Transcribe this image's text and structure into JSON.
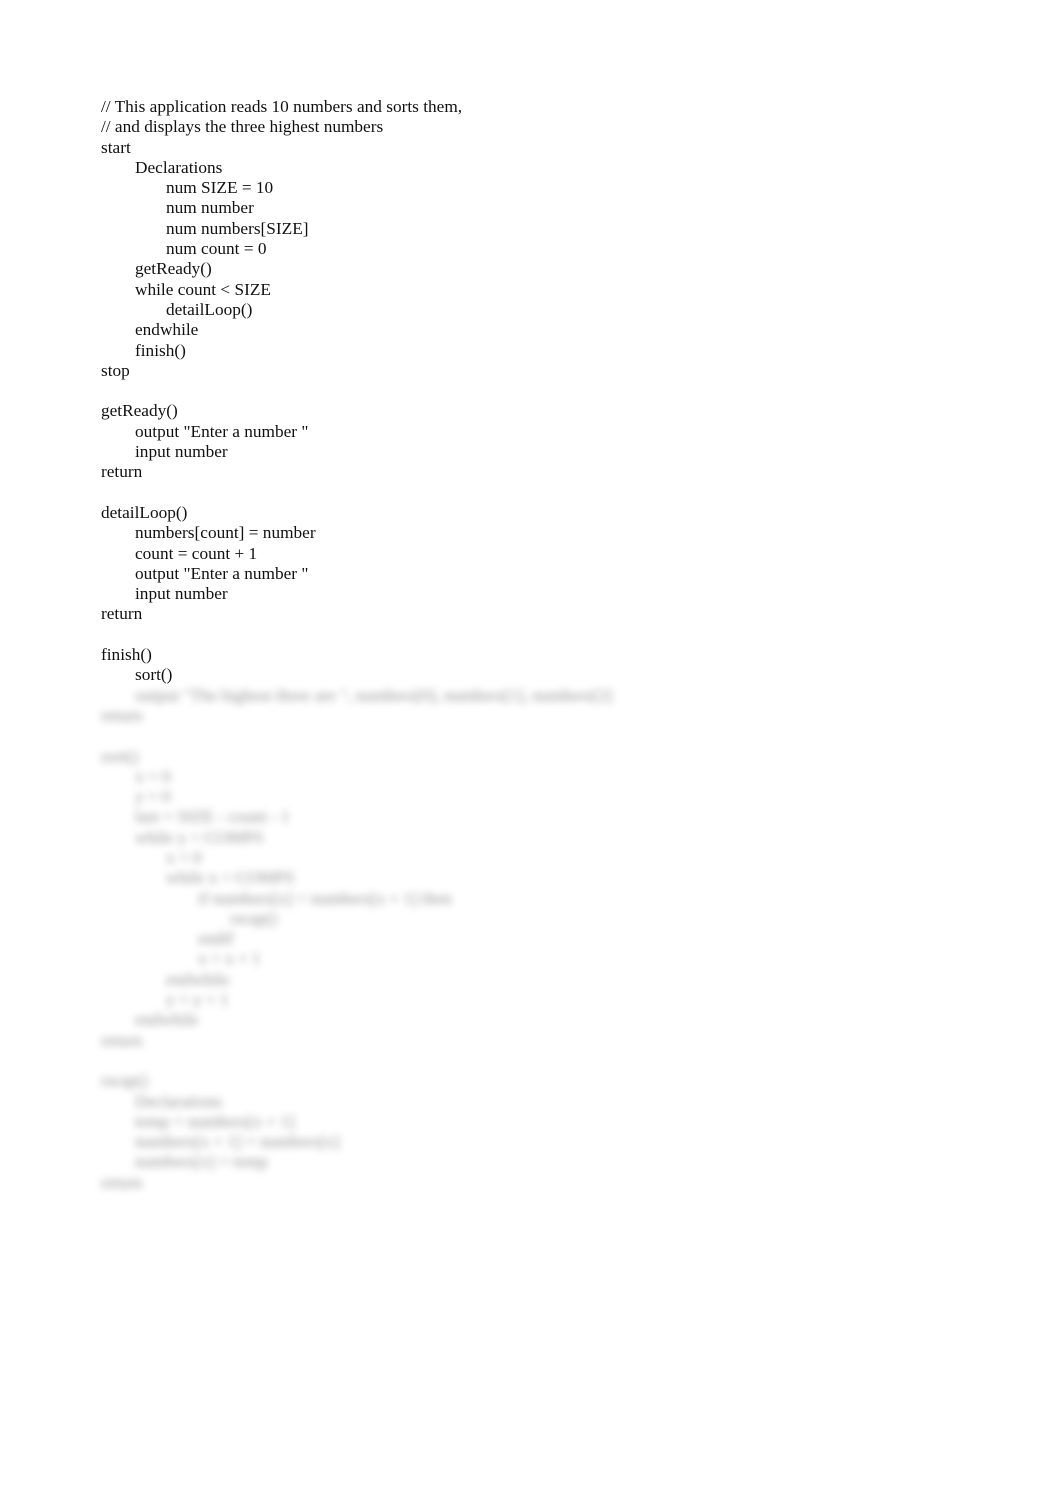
{
  "document": {
    "visible_lines": [
      {
        "indent": 0,
        "text": "// This application reads 10 numbers and sorts them,"
      },
      {
        "indent": 0,
        "text": "// and displays the three highest numbers"
      },
      {
        "indent": 0,
        "text": "start"
      },
      {
        "indent": 1,
        "text": "Declarations"
      },
      {
        "indent": 2,
        "text": "num SIZE = 10"
      },
      {
        "indent": 2,
        "text": "num number"
      },
      {
        "indent": 2,
        "text": "num numbers[SIZE]"
      },
      {
        "indent": 2,
        "text": "num count = 0"
      },
      {
        "indent": 1,
        "text": "getReady()"
      },
      {
        "indent": 1,
        "text": "while count < SIZE"
      },
      {
        "indent": 2,
        "text": "detailLoop()"
      },
      {
        "indent": 1,
        "text": "endwhile"
      },
      {
        "indent": 1,
        "text": "finish()"
      },
      {
        "indent": 0,
        "text": "stop"
      },
      {
        "indent": 0,
        "text": ""
      },
      {
        "indent": 0,
        "text": "getReady()"
      },
      {
        "indent": 1,
        "text": "output \"Enter a number \""
      },
      {
        "indent": 1,
        "text": "input number"
      },
      {
        "indent": 0,
        "text": "return"
      },
      {
        "indent": 0,
        "text": ""
      },
      {
        "indent": 0,
        "text": "detailLoop()"
      },
      {
        "indent": 1,
        "text": "numbers[count] = number"
      },
      {
        "indent": 1,
        "text": "count = count + 1"
      },
      {
        "indent": 1,
        "text": "output \"Enter a number \""
      },
      {
        "indent": 1,
        "text": "input number"
      },
      {
        "indent": 0,
        "text": "return"
      },
      {
        "indent": 0,
        "text": ""
      },
      {
        "indent": 0,
        "text": "finish()"
      },
      {
        "indent": 1,
        "text": "sort()"
      }
    ],
    "blurred_lines": [
      {
        "indent": 1,
        "text": "output \"The highest three are \", numbers[0], numbers[1], numbers[2]"
      },
      {
        "indent": 0,
        "text": "return"
      },
      {
        "indent": 0,
        "text": ""
      },
      {
        "indent": 0,
        "text": "sort()"
      },
      {
        "indent": 1,
        "text": "x = 0"
      },
      {
        "indent": 1,
        "text": "y = 0"
      },
      {
        "indent": 1,
        "text": "last = SIZE - count - 1"
      },
      {
        "indent": 1,
        "text": "while y < COMPS"
      },
      {
        "indent": 2,
        "text": "x = 0"
      },
      {
        "indent": 2,
        "text": "while x < COMPS"
      },
      {
        "indent": 3,
        "text": "if numbers[x] < numbers[x + 1] then"
      },
      {
        "indent": 4,
        "text": "swap()"
      },
      {
        "indent": 3,
        "text": "endif"
      },
      {
        "indent": 3,
        "text": "x = x + 1"
      },
      {
        "indent": 2,
        "text": "endwhile"
      },
      {
        "indent": 2,
        "text": "y = y + 1"
      },
      {
        "indent": 1,
        "text": "endwhile"
      },
      {
        "indent": 0,
        "text": "return"
      },
      {
        "indent": 0,
        "text": ""
      },
      {
        "indent": 0,
        "text": "swap()"
      },
      {
        "indent": 1,
        "text": "Declarations"
      },
      {
        "indent": 1,
        "text": "temp = numbers[x + 1]"
      },
      {
        "indent": 1,
        "text": "numbers[x + 1] = numbers[x]"
      },
      {
        "indent": 1,
        "text": "numbers[x] = temp"
      },
      {
        "indent": 0,
        "text": "return"
      }
    ]
  }
}
